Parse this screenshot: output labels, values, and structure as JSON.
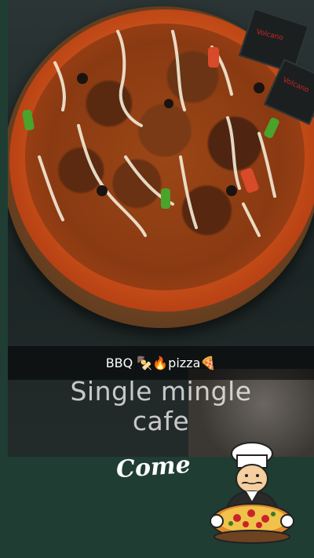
{
  "caption": "BBQ 🍢🔥pizza🍕",
  "headline": {
    "line1": "Single mingle",
    "line2": "cafe"
  },
  "come_text": "Come",
  "packet_text": "Volcano",
  "colors": {
    "background": "#1f3d33",
    "crust": "#c8521a",
    "caption_bar": "#000000"
  },
  "icons": [
    "chef-icon",
    "pizza-icon"
  ]
}
